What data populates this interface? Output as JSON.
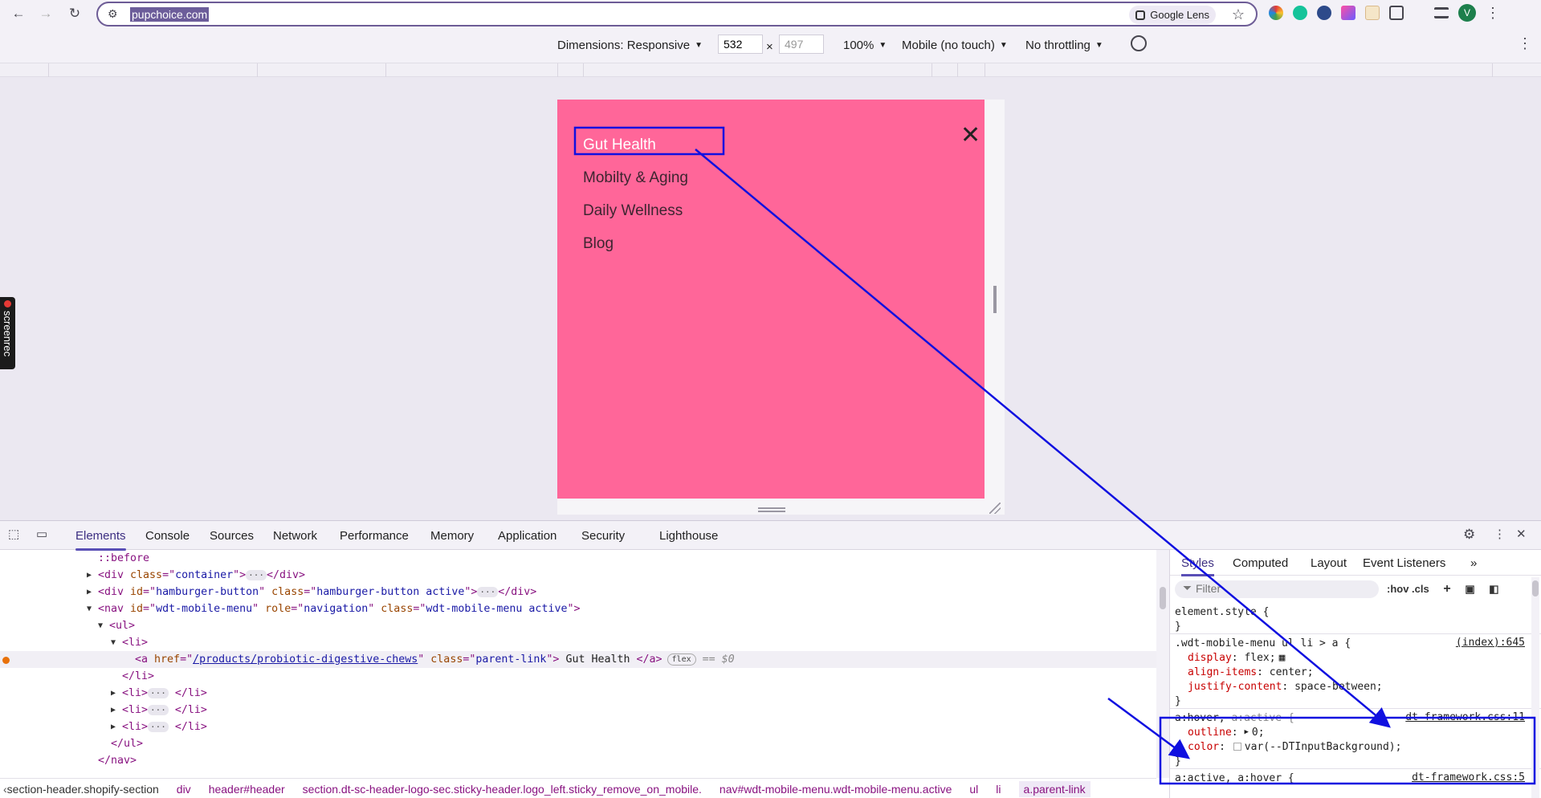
{
  "browser": {
    "url": "pupchoice.com",
    "lens_label": "Google Lens",
    "avatar_letter": "V"
  },
  "device_toolbar": {
    "dimensions_label": "Dimensions: Responsive",
    "width": "532",
    "x_sep": "×",
    "height": "497",
    "zoom": "100%",
    "device_type": "Mobile (no touch)",
    "throttling": "No throttling"
  },
  "screenrec_label": "screenrec",
  "mobile_menu": {
    "items": [
      "Gut Health",
      "Mobilty & Aging",
      "Daily Wellness",
      "Blog"
    ],
    "close_symbol": "✕"
  },
  "devtools": {
    "tabs": [
      "Elements",
      "Console",
      "Sources",
      "Network",
      "Performance",
      "Memory",
      "Application",
      "Security",
      "Lighthouse"
    ],
    "dom": {
      "before": "::before",
      "container_class": "container",
      "hamburger_id": "hamburger-button",
      "hamburger_class": "hamburger-button active",
      "nav_id": "wdt-mobile-menu",
      "nav_role": "navigation",
      "nav_class": "wdt-mobile-menu active",
      "link_href": "/products/probiotic-digestive-chews",
      "link_class": "parent-link",
      "link_text": "Gut Health",
      "flex_badge": "flex",
      "eq_marker": "== $0"
    },
    "styles_tabs": [
      "Styles",
      "Computed",
      "Layout",
      "Event Listeners"
    ],
    "filter_placeholder": "Filter",
    "filter_toggles": ":hov .cls",
    "rules": {
      "element_style": "element.style {",
      "rule1_selector": ".wdt-mobile-menu ul li > a {",
      "rule1_source": "(index):645",
      "rule1_props": [
        {
          "name": "display",
          "value": "flex;"
        },
        {
          "name": "align-items",
          "value": "center;"
        },
        {
          "name": "justify-content",
          "value": "space-between;"
        }
      ],
      "rule2_selector_a": "a:hover,",
      "rule2_selector_b": "a:active {",
      "rule2_source": "dt-framework.css:11",
      "rule2_props": [
        {
          "name": "outline",
          "value": "0;"
        },
        {
          "name": "color",
          "value": "var(--DTInputBackground);"
        }
      ],
      "rule3_selector": "a:active, a:hover {",
      "rule3_source": "dt-framework.css:5"
    },
    "breadcrumbs": [
      "section-header.shopify-section",
      "div",
      "header#header",
      "section.dt-sc-header-logo-sec.sticky-header.logo_left.sticky_remove_on_mobile.",
      "nav#wdt-mobile-menu.wdt-mobile-menu.active",
      "ul",
      "li",
      "a.parent-link"
    ]
  },
  "colors": {
    "menu_background": "#ff6699",
    "annotation": "#1010e0",
    "accent": "#5a4fb6"
  }
}
